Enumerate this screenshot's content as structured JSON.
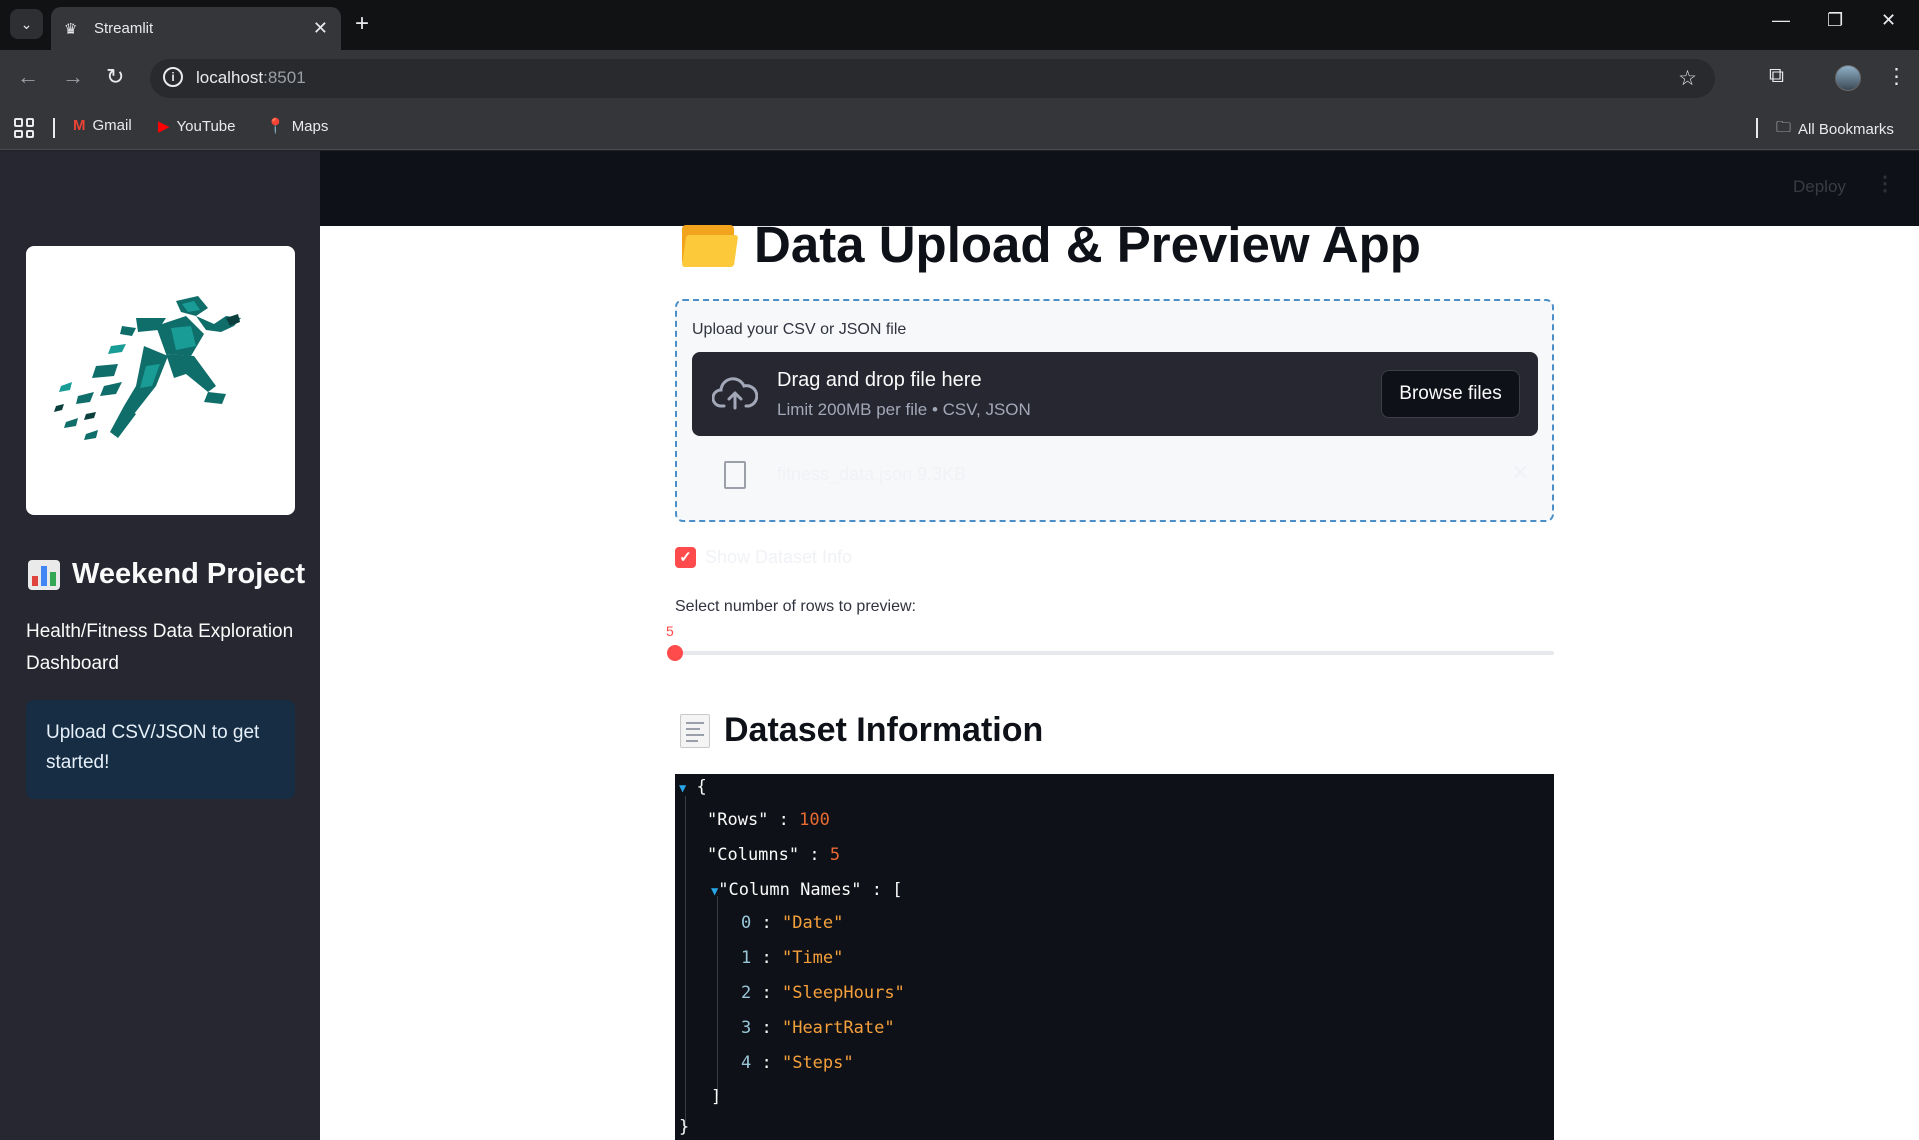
{
  "browser": {
    "tab_title": "Streamlit",
    "url_host": "localhost",
    "url_port": ":8501",
    "bookmarks": [
      {
        "label": "Gmail"
      },
      {
        "label": "YouTube"
      },
      {
        "label": "Maps"
      }
    ],
    "all_bookmarks": "All Bookmarks"
  },
  "header": {
    "deploy_label": "Deploy"
  },
  "sidebar": {
    "title": "Weekend Project",
    "subtitle": "Health/Fitness Data Exploration Dashboard",
    "info_message": "Upload CSV/JSON to get started!"
  },
  "main": {
    "title": "Data Upload & Preview App",
    "uploader": {
      "label": "Upload your CSV or JSON file",
      "drop_text": "Drag and drop file here",
      "limit_text": "Limit 200MB per file • CSV, JSON",
      "browse_label": "Browse files",
      "file_name": "fitness_data.json",
      "file_size": "9.3KB"
    },
    "checkbox": {
      "label": "Show Dataset Info",
      "checked": true
    },
    "slider": {
      "label": "Select number of rows to preview:",
      "value": "5",
      "fraction": 0.0
    },
    "section_title": "Dataset Information",
    "json_view": {
      "rows_key": "\"Rows\"",
      "rows_value": "100",
      "columns_key": "\"Columns\"",
      "columns_value": "5",
      "names_key": "\"Column Names\"",
      "names": [
        "\"Date\"",
        "\"Time\"",
        "\"SleepHours\"",
        "\"HeartRate\"",
        "\"Steps\""
      ]
    }
  },
  "colors": {
    "accent": "#ff4b4b",
    "sidebar_bg": "#262730",
    "info_bg": "#172d43",
    "uploader_border": "#4a8fc8"
  }
}
